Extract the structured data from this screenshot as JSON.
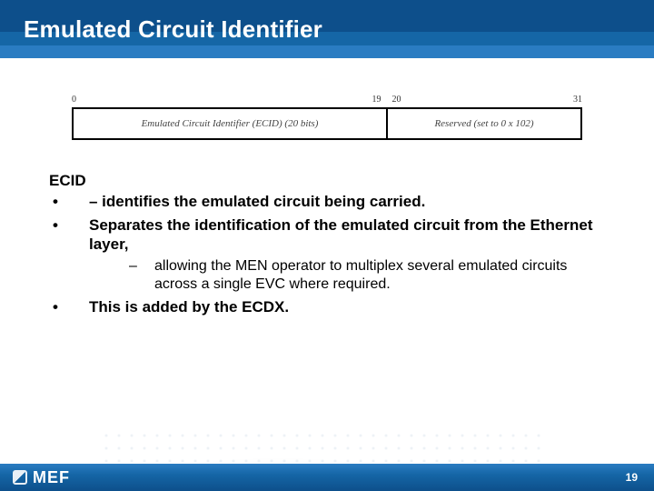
{
  "header": {
    "title": "Emulated Circuit Identifier"
  },
  "diagram": {
    "bits": {
      "start": "0",
      "mid_left": "19",
      "mid_right": "20",
      "end": "31"
    },
    "left_label": "Emulated Circuit Identifier (ECID) (20 bits)",
    "right_label": "Reserved (set to 0 x 102)"
  },
  "body": {
    "heading": "ECID",
    "items": [
      {
        "text": "– identifies the emulated circuit being carried."
      },
      {
        "text": "Separates the identification of the emulated circuit from the Ethernet layer,",
        "sub": [
          "allowing the MEN operator to multiplex several emulated circuits across a single EVC where required."
        ]
      },
      {
        "text": "This is added by the ECDX."
      }
    ]
  },
  "footer": {
    "logo_text": "MEF",
    "page_number": "19"
  }
}
